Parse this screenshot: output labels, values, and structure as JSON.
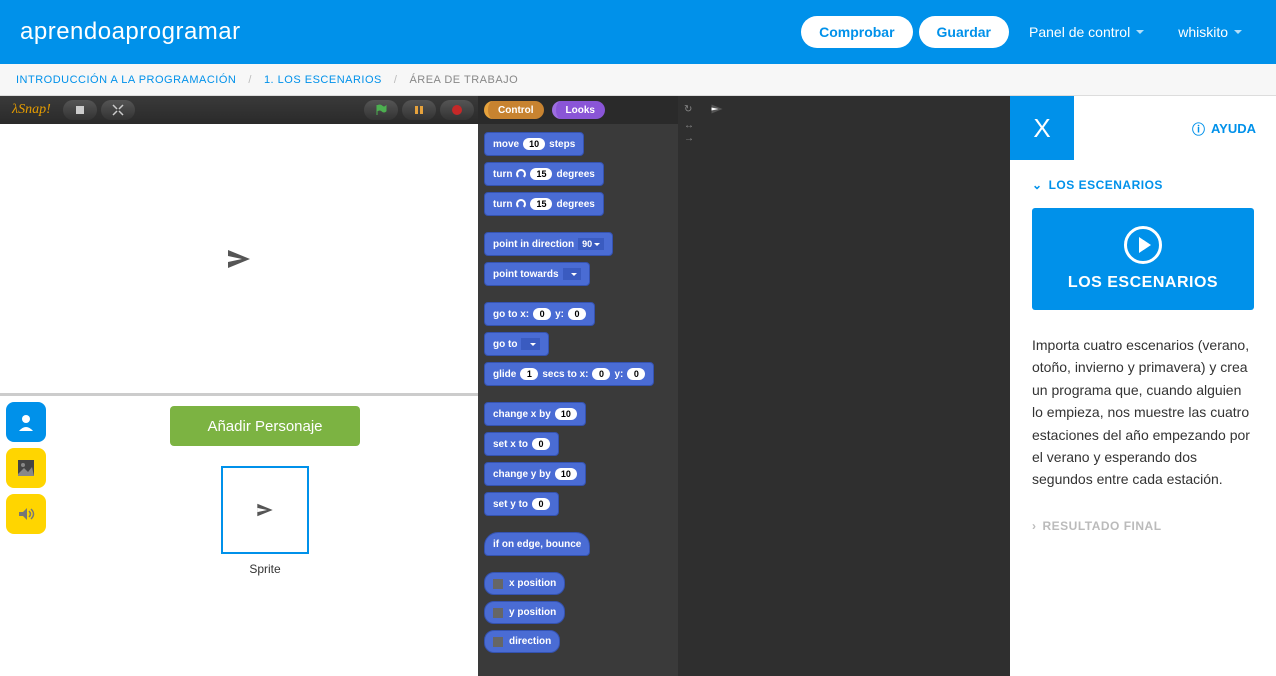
{
  "header": {
    "logo": "aprendoaprogramar",
    "comprobar": "Comprobar",
    "guardar": "Guardar",
    "panel": "Panel de control",
    "user": "whiskito"
  },
  "breadcrumb": {
    "l1": "INTRODUCCIÓN A LA PROGRAMACIÓN",
    "l2": "1. LOS ESCENARIOS",
    "l3": "ÁREA DE TRABAJO"
  },
  "snap_logo": "λSnap!",
  "categories": {
    "control": "Control",
    "looks": "Looks"
  },
  "blocks": {
    "move": "move",
    "steps": "steps",
    "move_v": "10",
    "turn": "turn",
    "degrees": "degrees",
    "turn_v": "15",
    "point_dir": "point in direction",
    "point_dir_v": "90",
    "point_towards": "point towards",
    "goto_xy": "go to x:",
    "y": "y:",
    "zero": "0",
    "goto": "go to",
    "glide": "glide",
    "secs_to_x": "secs to x:",
    "glide_v": "1",
    "change_x": "change x by",
    "ten": "10",
    "set_x": "set x to",
    "change_y": "change y by",
    "set_y": "set y to",
    "bounce": "if on edge, bounce",
    "xpos": "x position",
    "ypos": "y position",
    "dir": "direction"
  },
  "sprite": {
    "add": "Añadir Personaje",
    "label": "Sprite"
  },
  "help": {
    "x": "X",
    "ayuda": "AYUDA",
    "section1": "LOS ESCENARIOS",
    "video": "LOS ESCENARIOS",
    "text": "Importa cuatro escenarios (verano, otoño, invierno y primavera) y crea un programa que, cuando alguien lo empieza, nos muestre las cuatro estaciones del año empezando por el verano y esperando dos segundos entre cada estación.",
    "section2": "RESULTADO FINAL"
  }
}
